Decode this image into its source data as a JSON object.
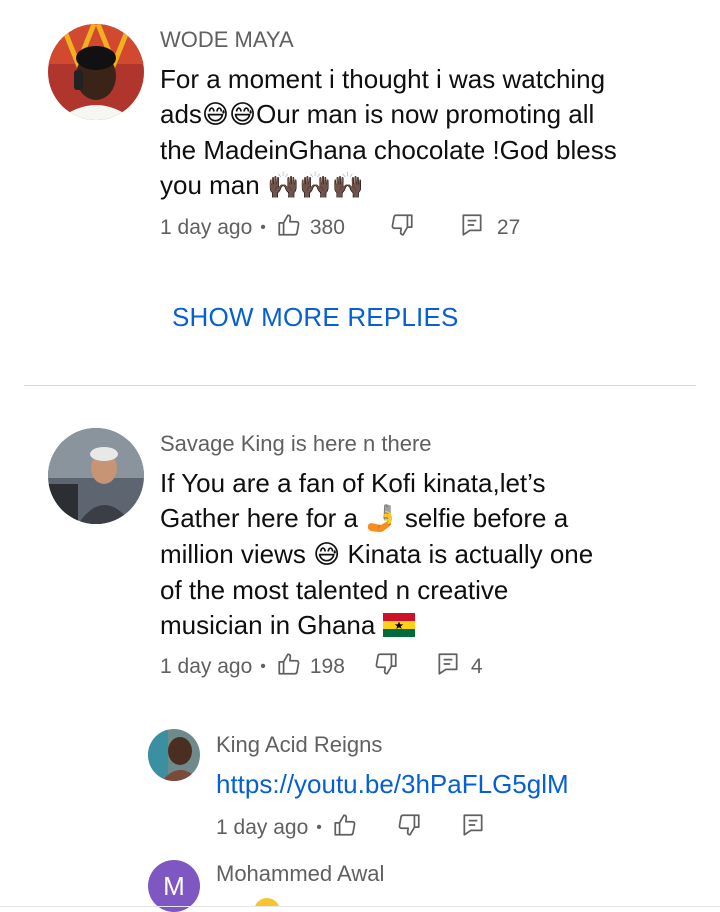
{
  "comments": [
    {
      "author": "WODE MAYA",
      "text_line1": "For a moment i thought i was watching",
      "text_line2_a": "ads",
      "text_line2_b": "Our man is now promoting all",
      "text_line3": "the MadeinGhana chocolate !God bless",
      "text_line4": "you man",
      "time": "1 day ago",
      "likes": "380",
      "replies": "27",
      "avatar_icon": "person-with-phone-avatar"
    },
    {
      "author": "Savage King is here n there",
      "text_line1": "If You are a fan of Kofi kinata,let’s",
      "text_line2_a": "Gather here for a",
      "text_line2_b": "selfie before a",
      "text_line3_a": "million views",
      "text_line3_b": "Kinata is actually one",
      "text_line4": "of the most talented n creative",
      "text_line5": "musician in Ghana",
      "time": "1 day ago",
      "likes": "198",
      "replies": "4",
      "avatar_icon": "man-in-car-avatar"
    }
  ],
  "show_more_replies": "SHOW MORE REPLIES",
  "replies": [
    {
      "author": "King Acid Reigns",
      "link": "https://youtu.be/3hPaFLG5glM",
      "time": "1 day ago",
      "avatar_icon": "person-photo-avatar"
    },
    {
      "author": "Mohammed Awal",
      "avatar_letter": "M",
      "avatar_color": "#7e57c2"
    }
  ],
  "colors": {
    "link": "#065fd4",
    "secondary_text": "#606060",
    "primary_text": "#0f0f0f"
  },
  "emojis": {
    "sweat_smile": "sweat-smile-emoji",
    "raising_hands": "raising-hands-emoji",
    "selfie": "selfie-emoji",
    "ghana_flag": "ghana-flag-emoji"
  }
}
